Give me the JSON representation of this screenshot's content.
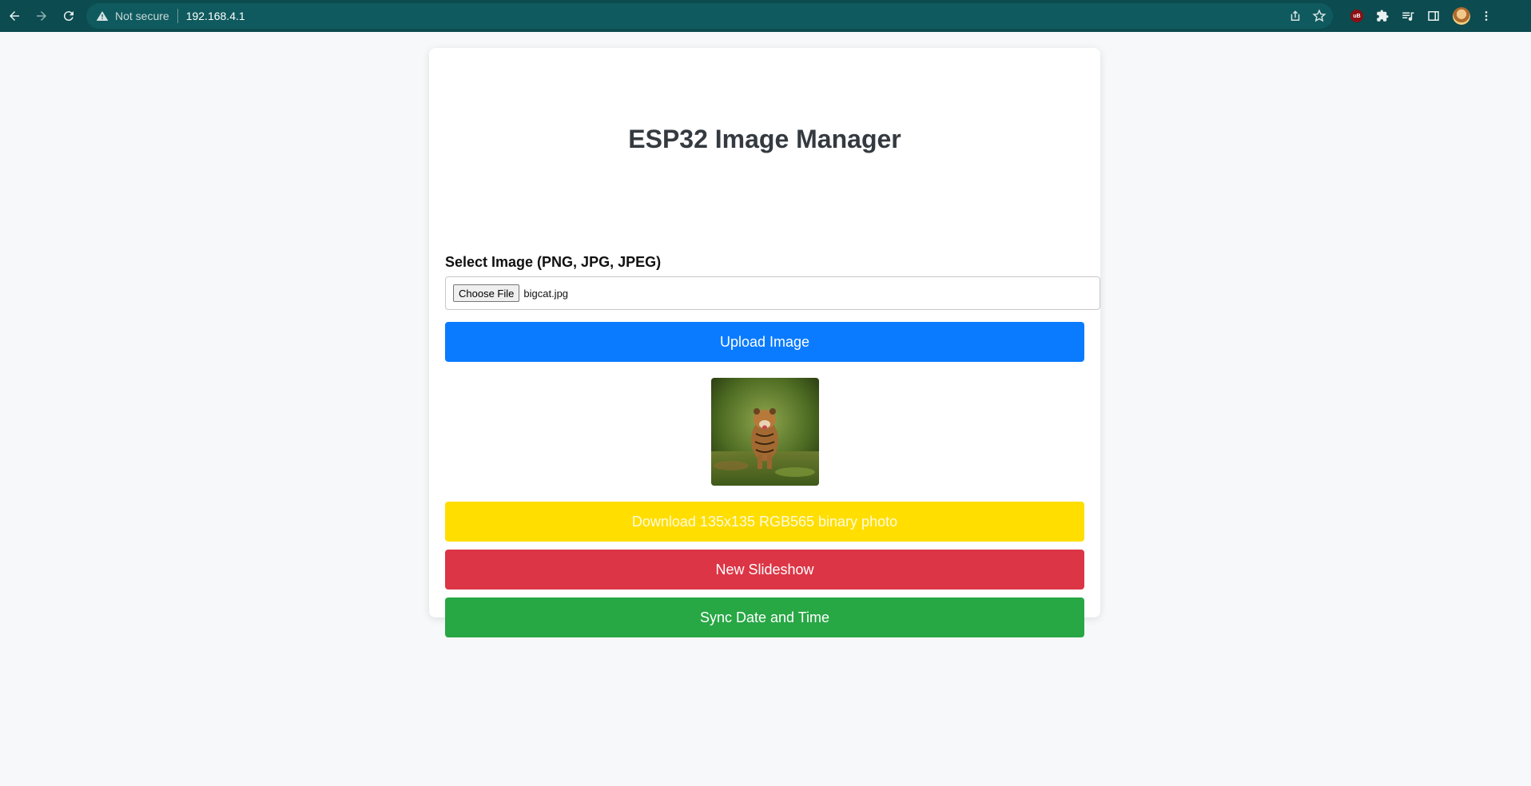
{
  "browser": {
    "security_label": "Not secure",
    "url": "192.168.4.1",
    "extension_badge": "uB"
  },
  "page": {
    "title": "ESP32 Image Manager",
    "file_label": "Select Image (PNG, JPG, JPEG)",
    "choose_file_label": "Choose File",
    "file_name": "bigcat.jpg",
    "upload_label": "Upload Image",
    "download_label": "Download 135x135 RGB565 binary photo",
    "slideshow_label": "New Slideshow",
    "sync_label": "Sync Date and Time"
  },
  "colors": {
    "topbar": "#0c4b4f",
    "upload": "#0a7bff",
    "download": "#ffde00",
    "slideshow": "#dc3545",
    "sync": "#28a745"
  }
}
